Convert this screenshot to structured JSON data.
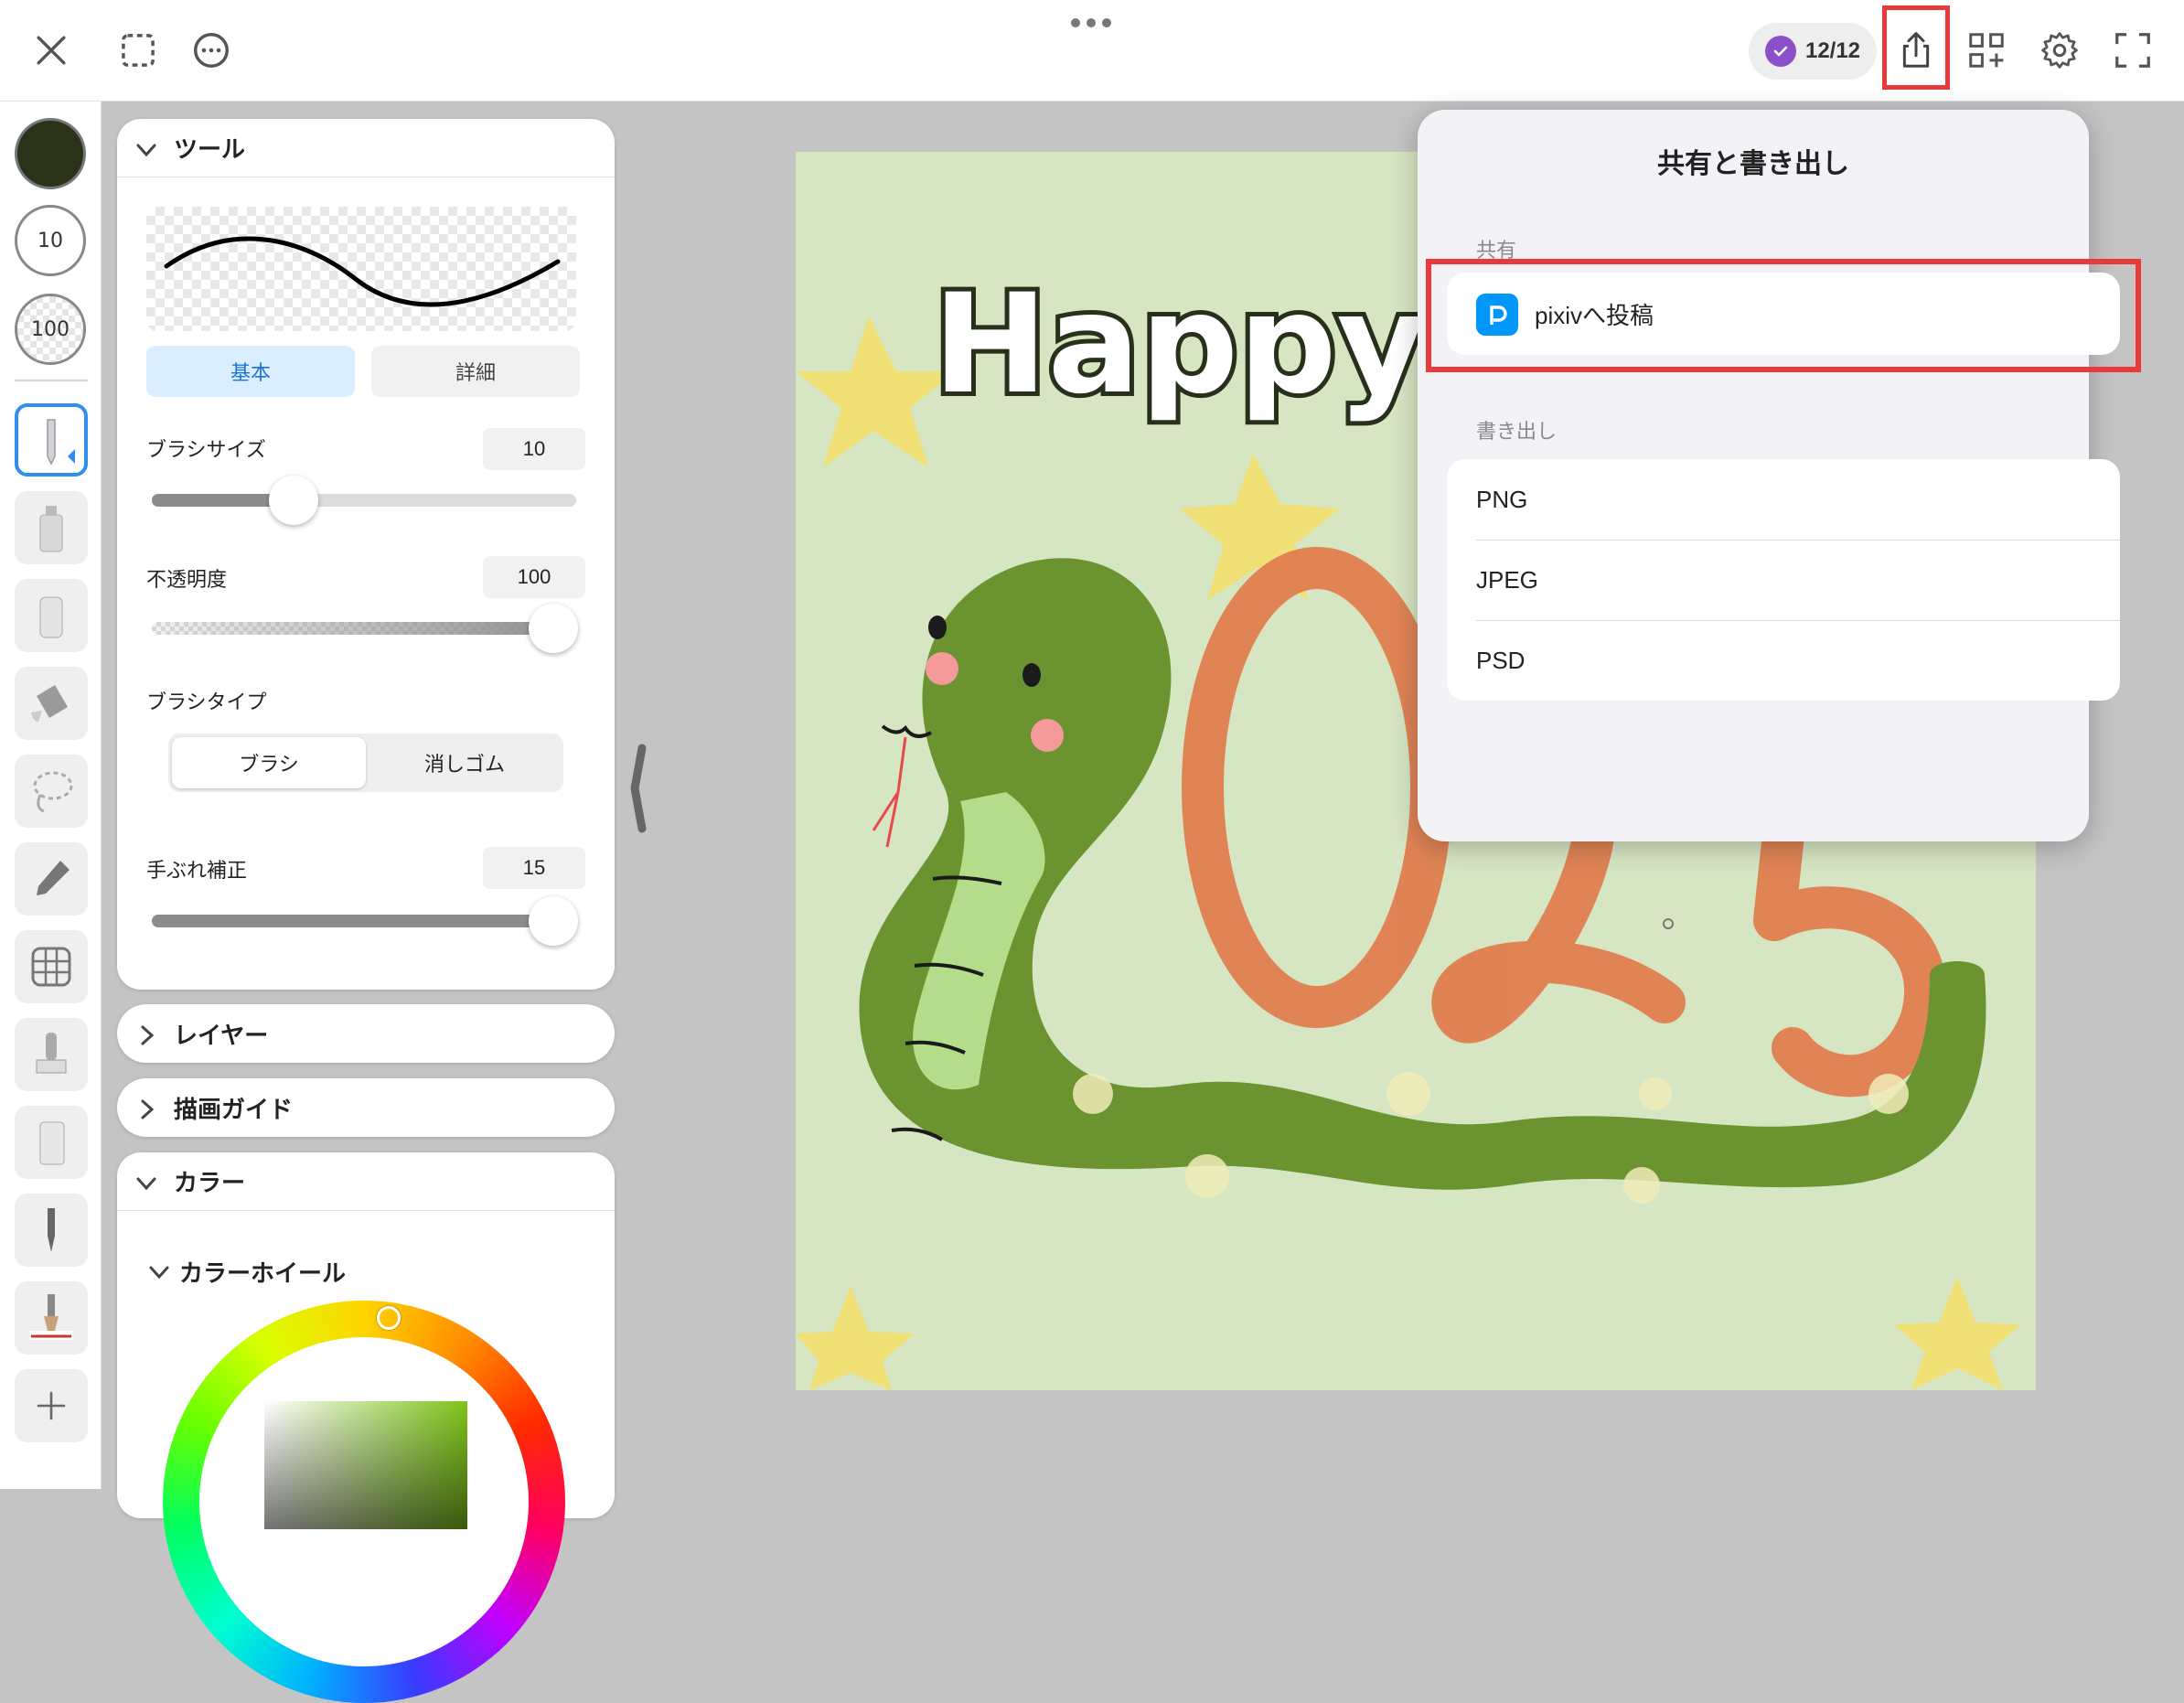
{
  "topbar": {
    "credit_text": "12/12",
    "icons": [
      "close-icon",
      "selection-icon",
      "more-icon",
      "share-icon",
      "add-grid-icon",
      "gear-icon",
      "fullscreen-icon"
    ]
  },
  "left_toolbar": {
    "brush_color": "#2a3319",
    "size_value": "10",
    "opacity_value": "100"
  },
  "tool_panel": {
    "title": "ツール",
    "tabs": [
      "基本",
      "詳細"
    ],
    "brush_size_label": "ブラシサイズ",
    "brush_size_value": "10",
    "brush_size_level": 0.33,
    "opacity_label": "不透明度",
    "opacity_value": "100",
    "opacity_level": 1.0,
    "brush_type_label": "ブラシタイプ",
    "brush_types": [
      "ブラシ",
      "消しゴム"
    ],
    "stabilizer_label": "手ぶれ補正",
    "stabilizer_value": "15",
    "stabilizer_level": 1.0
  },
  "panels": {
    "layer": "レイヤー",
    "guide": "描画ガイド",
    "color": "カラー",
    "color_wheel": "カラーホイール"
  },
  "canvas": {
    "artwork_text": "HappyN",
    "year_text": "2025",
    "background_color": "#d6e6c3"
  },
  "share_popover": {
    "title": "共有と書き出し",
    "share_section": "共有",
    "pixiv_label": "pixivへ投稿",
    "export_section": "書き出し",
    "export_options": [
      "PNG",
      "JPEG",
      "PSD"
    ]
  },
  "colors": {
    "accent": "#2e8ff0",
    "highlight": "#e83a3a",
    "pixiv": "#0096fa",
    "snake": "#6b9330",
    "number": "#e07e50"
  }
}
